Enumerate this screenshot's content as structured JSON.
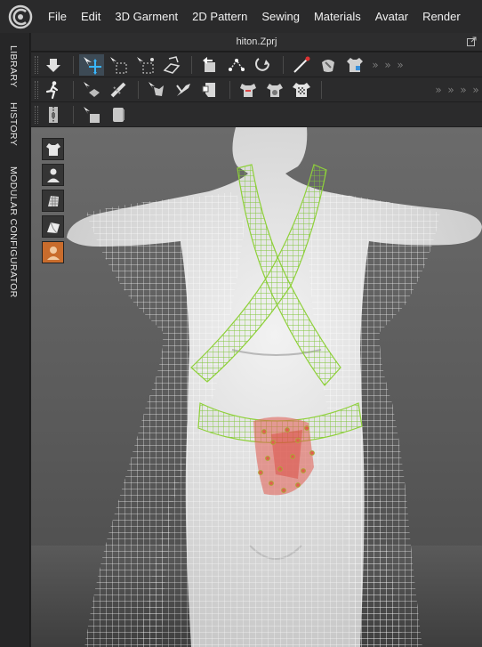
{
  "menu": {
    "items": [
      "File",
      "Edit",
      "3D Garment",
      "2D Pattern",
      "Sewing",
      "Materials",
      "Avatar",
      "Render"
    ]
  },
  "sidebar": {
    "tabs": [
      "LIBRARY",
      "HISTORY",
      "MODULAR CONFIGURATOR"
    ]
  },
  "window": {
    "title": "hiton.Zprj"
  },
  "colors": {
    "menubar": "#2a2a2b",
    "toolbar": "#2b2b2c",
    "viewport": "#626262",
    "garment_mesh": "#ffffff",
    "strap_mesh": "#8fd13a",
    "selection_points": "#e05a4f",
    "active_tool": "#c96c2c"
  },
  "toolbar": {
    "row1": [
      "move-down-icon",
      "transform-pattern-icon",
      "select-mesh-box-icon",
      "select-mesh-lasso-icon",
      "fold-arrangement-icon",
      "flatten-icon",
      "tack-icon",
      "tack-on-avatar-icon",
      "pin-icon",
      "steam-icon",
      "garment-fit-icon"
    ],
    "row2": [
      "simulate-walk-icon",
      "edit-sewing-icon",
      "edit-tack-icon",
      "reset-3d-icon",
      "fold-icon",
      "pattern-piece-icon",
      "measure-garment-icon",
      "quick-fit-icon",
      "shirt-checker-icon"
    ],
    "row3": [
      "zipper-icon",
      "select-fabric-icon",
      "cylinder-icon"
    ]
  },
  "viewport_tools": [
    "garment-display-icon",
    "avatar-display-icon",
    "fabric-render-icon",
    "texture-surface-icon",
    "avatar-show-icon"
  ]
}
